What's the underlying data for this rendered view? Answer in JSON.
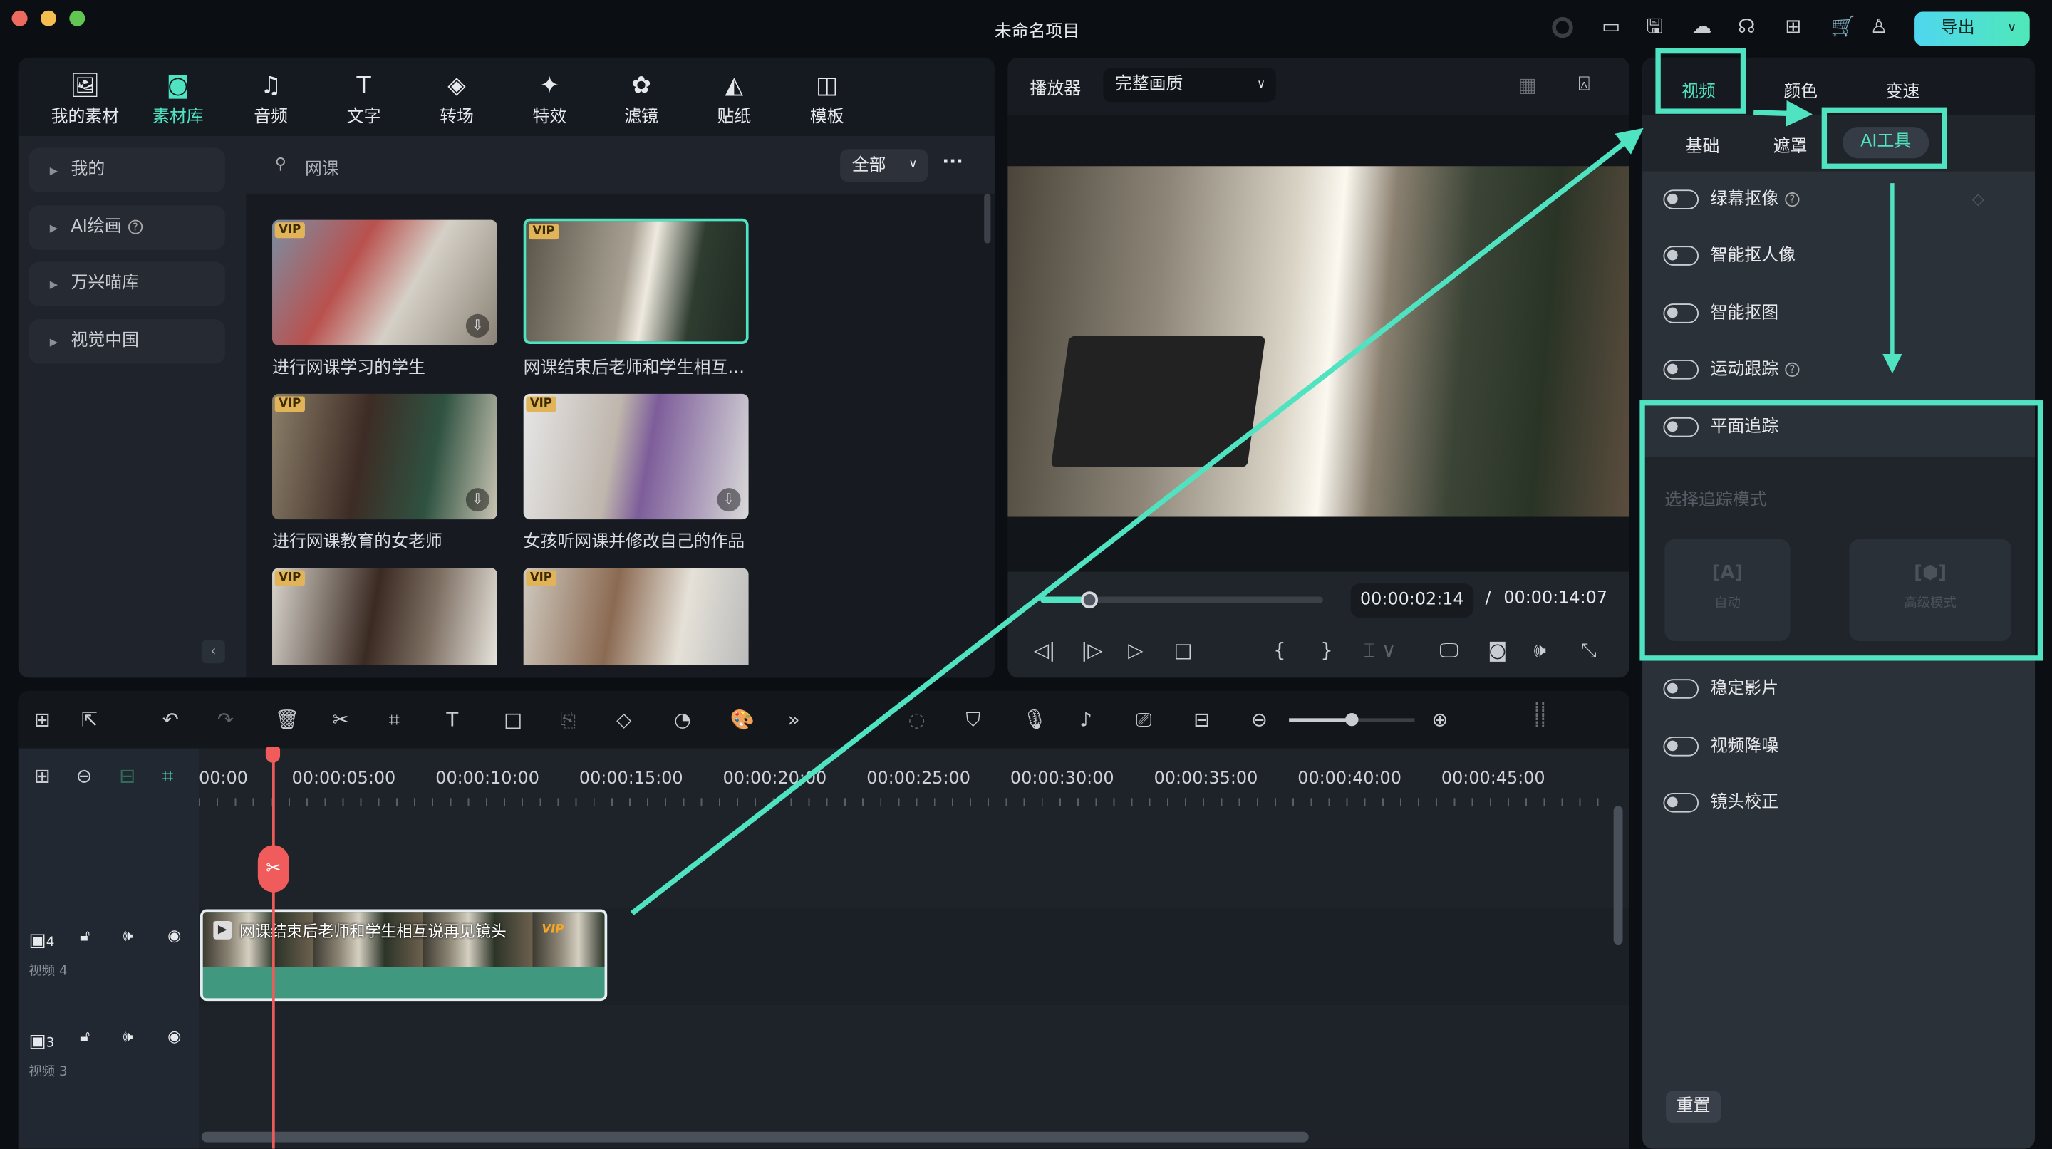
{
  "window": {
    "title": "未命名项目",
    "export_label": "导出",
    "accent": "#4fe3c1"
  },
  "topbar_icons": [
    "spinner-icon",
    "layout-icon",
    "save-icon",
    "cloud-icon",
    "headset-icon",
    "grid-icon",
    "cart-icon",
    "user-icon"
  ],
  "media_tabs": [
    {
      "label": "我的素材",
      "icon": "media-icon"
    },
    {
      "label": "素材库",
      "icon": "library-icon",
      "active": true
    },
    {
      "label": "音频",
      "icon": "music-icon"
    },
    {
      "label": "文字",
      "icon": "text-icon"
    },
    {
      "label": "转场",
      "icon": "transition-icon"
    },
    {
      "label": "特效",
      "icon": "effects-icon"
    },
    {
      "label": "滤镜",
      "icon": "filter-icon"
    },
    {
      "label": "贴纸",
      "icon": "sticker-icon"
    },
    {
      "label": "模板",
      "icon": "template-icon"
    }
  ],
  "sidebar": [
    {
      "label": "我的"
    },
    {
      "label": "AI绘画"
    },
    {
      "label": "万兴喵库"
    },
    {
      "label": "视觉中国"
    }
  ],
  "search": {
    "value": "网课",
    "filter": "全部"
  },
  "thumbnails": [
    {
      "label": "进行网课学习的学生",
      "badge": "VIP"
    },
    {
      "label": "网课结束后老师和学生相互说再见镜头",
      "badge": "VIP",
      "selected": true
    },
    {
      "label": "进行网课教育的女老师",
      "badge": "VIP"
    },
    {
      "label": "女孩听网课并修改自己的作品",
      "badge": "VIP"
    },
    {
      "label": "",
      "badge": "VIP"
    },
    {
      "label": "",
      "badge": "VIP"
    }
  ],
  "player": {
    "label": "播放器",
    "quality": "完整画质",
    "current_time": "00:00:02:14",
    "separator": "/",
    "total_time": "00:00:14:07",
    "progress": 0.17
  },
  "right_panel": {
    "tabs": [
      {
        "label": "视频",
        "active": true
      },
      {
        "label": "颜色"
      },
      {
        "label": "变速"
      }
    ],
    "subtabs": [
      {
        "label": "基础"
      },
      {
        "label": "遮罩"
      },
      {
        "label": "AI工具",
        "active": true
      }
    ],
    "items": [
      {
        "label": "绿幕抠像",
        "help": true,
        "on": false
      },
      {
        "label": "智能抠人像",
        "on": false
      },
      {
        "label": "智能抠图",
        "on": false
      },
      {
        "label": "运动跟踪",
        "help": true,
        "on": false
      },
      {
        "label": "平面追踪",
        "on": false
      }
    ],
    "tracking": {
      "mode_label": "选择追踪模式",
      "auto": "自动",
      "advanced": "高级模式"
    },
    "items2": [
      {
        "label": "稳定影片",
        "on": false
      },
      {
        "label": "视频降噪",
        "on": false
      },
      {
        "label": "镜头校正",
        "on": false
      }
    ],
    "reset_label": "重置"
  },
  "timeline": {
    "ruler": [
      "00:00",
      "00:00:05:00",
      "00:00:10:00",
      "00:00:15:00",
      "00:00:20:00",
      "00:00:25:00",
      "00:00:30:00",
      "00:00:35:00",
      "00:00:40:00",
      "00:00:45:00"
    ],
    "zoom_level": 0.5,
    "tracks": [
      {
        "num": "4",
        "name": "视频 4"
      },
      {
        "num": "3",
        "name": "视频 3"
      }
    ],
    "clip": {
      "title": "网课结束后老师和学生相互说再见镜头",
      "badge": "VIP"
    }
  }
}
